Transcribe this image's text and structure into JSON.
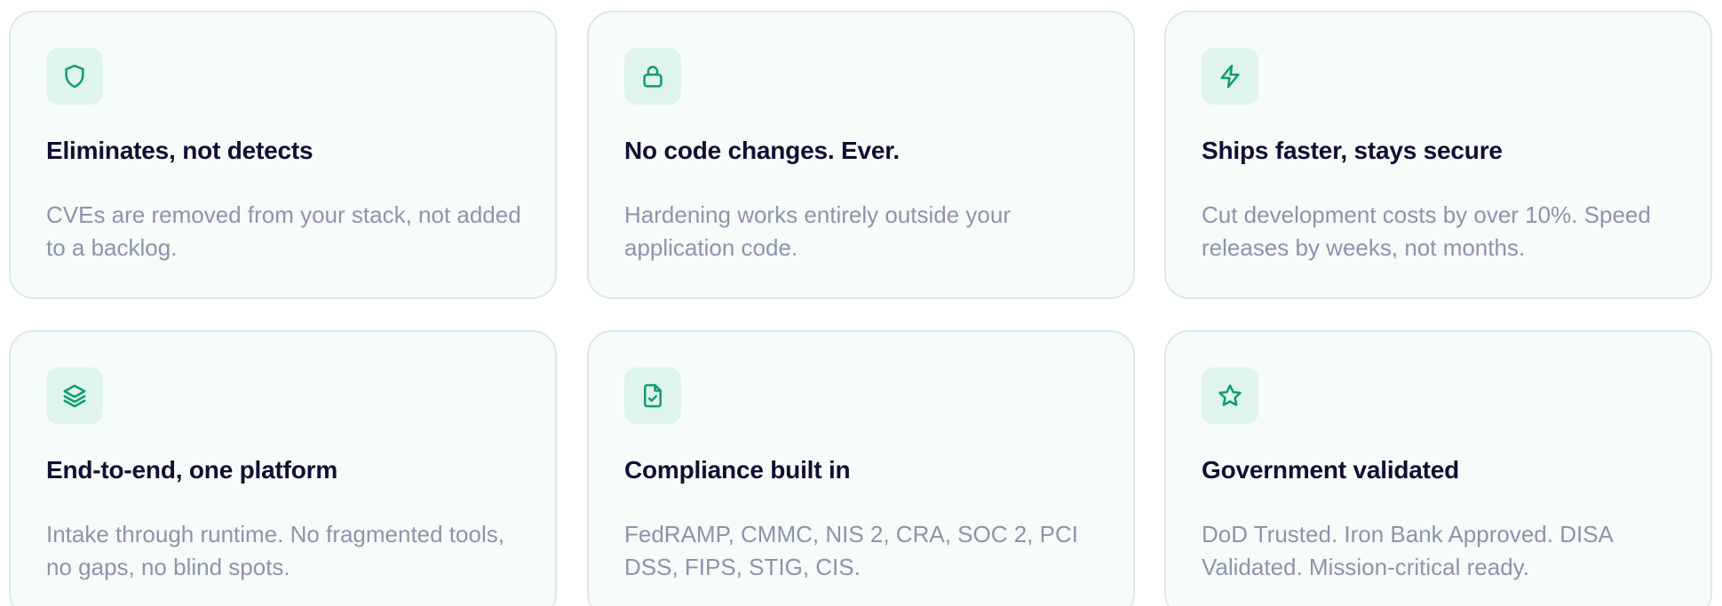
{
  "features": [
    {
      "icon": "shield-icon",
      "title": "Eliminates, not detects",
      "description": "CVEs are removed from your stack, not added to a backlog."
    },
    {
      "icon": "lock-icon",
      "title": "No code changes. Ever.",
      "description": "Hardening works entirely outside your application code."
    },
    {
      "icon": "lightning-icon",
      "title": "Ships faster, stays secure",
      "description": "Cut development costs by over 10%. Speed releases by weeks, not months."
    },
    {
      "icon": "layers-icon",
      "title": "End-to-end, one platform",
      "description": "Intake through runtime. No fragmented tools, no gaps, no blind spots."
    },
    {
      "icon": "file-check-icon",
      "title": "Compliance built in",
      "description": "FedRAMP, CMMC, NIS 2, CRA, SOC 2, PCI DSS, FIPS, STIG, CIS."
    },
    {
      "icon": "star-icon",
      "title": "Government validated",
      "description": "DoD Trusted. Iron Bank Approved. DISA Validated. Mission-critical ready."
    }
  ],
  "colors": {
    "accent": "#0f9d6e",
    "icon_background": "#dff4ec",
    "card_background": "#f5fcf9",
    "card_border": "#dde8ea",
    "title": "#0e1033",
    "description": "#8e93ad"
  }
}
